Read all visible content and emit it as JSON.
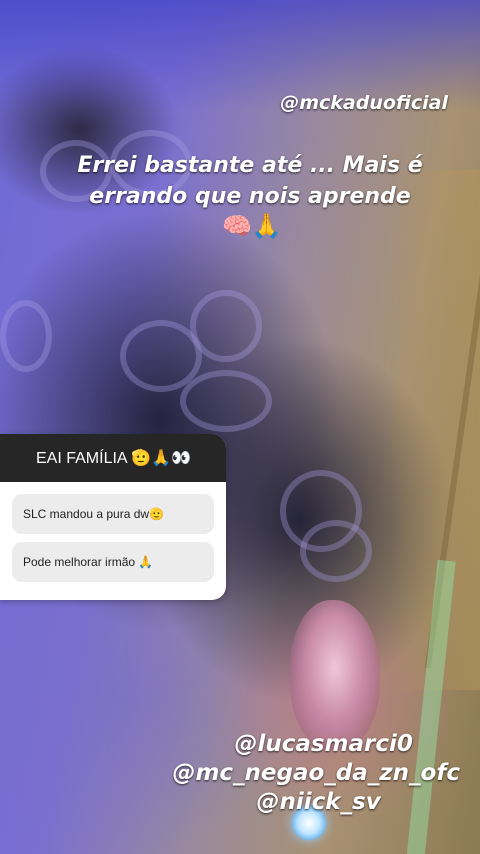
{
  "story": {
    "mention_top": "@mckaduoficial",
    "caption": "Errei bastante até ... Mais é errando que nois aprende",
    "caption_emoji": "🧠🙏",
    "question_box": {
      "title": "EAI FAMÍLIA 🫡🙏👀",
      "answers": [
        "SLC mandou a pura dw🫡",
        "Pode melhorar irmão 🙏"
      ]
    },
    "mentions_bottom": [
      "@lucasmarci0",
      "@mc_negao_da_zn_ofc",
      "@niick_sv"
    ]
  }
}
